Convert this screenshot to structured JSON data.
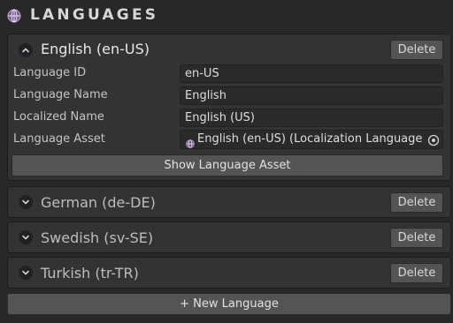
{
  "header": {
    "title": "LANGUAGES",
    "icon": "globe-icon"
  },
  "languages": [
    {
      "title": "English (en-US)",
      "expanded": true,
      "delete_label": "Delete",
      "fields": {
        "id_label": "Language ID",
        "id_value": "en-US",
        "name_label": "Language Name",
        "name_value": "English",
        "localized_label": "Localized Name",
        "localized_value": "English (US)",
        "asset_label": "Language Asset",
        "asset_value": "English (en-US) (Localization Language)"
      },
      "show_asset_label": "Show Language Asset"
    },
    {
      "title": "German (de-DE)",
      "expanded": false,
      "delete_label": "Delete"
    },
    {
      "title": "Swedish (sv-SE)",
      "expanded": false,
      "delete_label": "Delete"
    },
    {
      "title": "Turkish (tr-TR)",
      "expanded": false,
      "delete_label": "Delete"
    }
  ],
  "new_language_label": "+ New Language",
  "colors": {
    "background": "#282828",
    "panel": "#333333",
    "button": "#545454",
    "field": "#2a2a2a",
    "globe_accent": "#b48ad6"
  }
}
